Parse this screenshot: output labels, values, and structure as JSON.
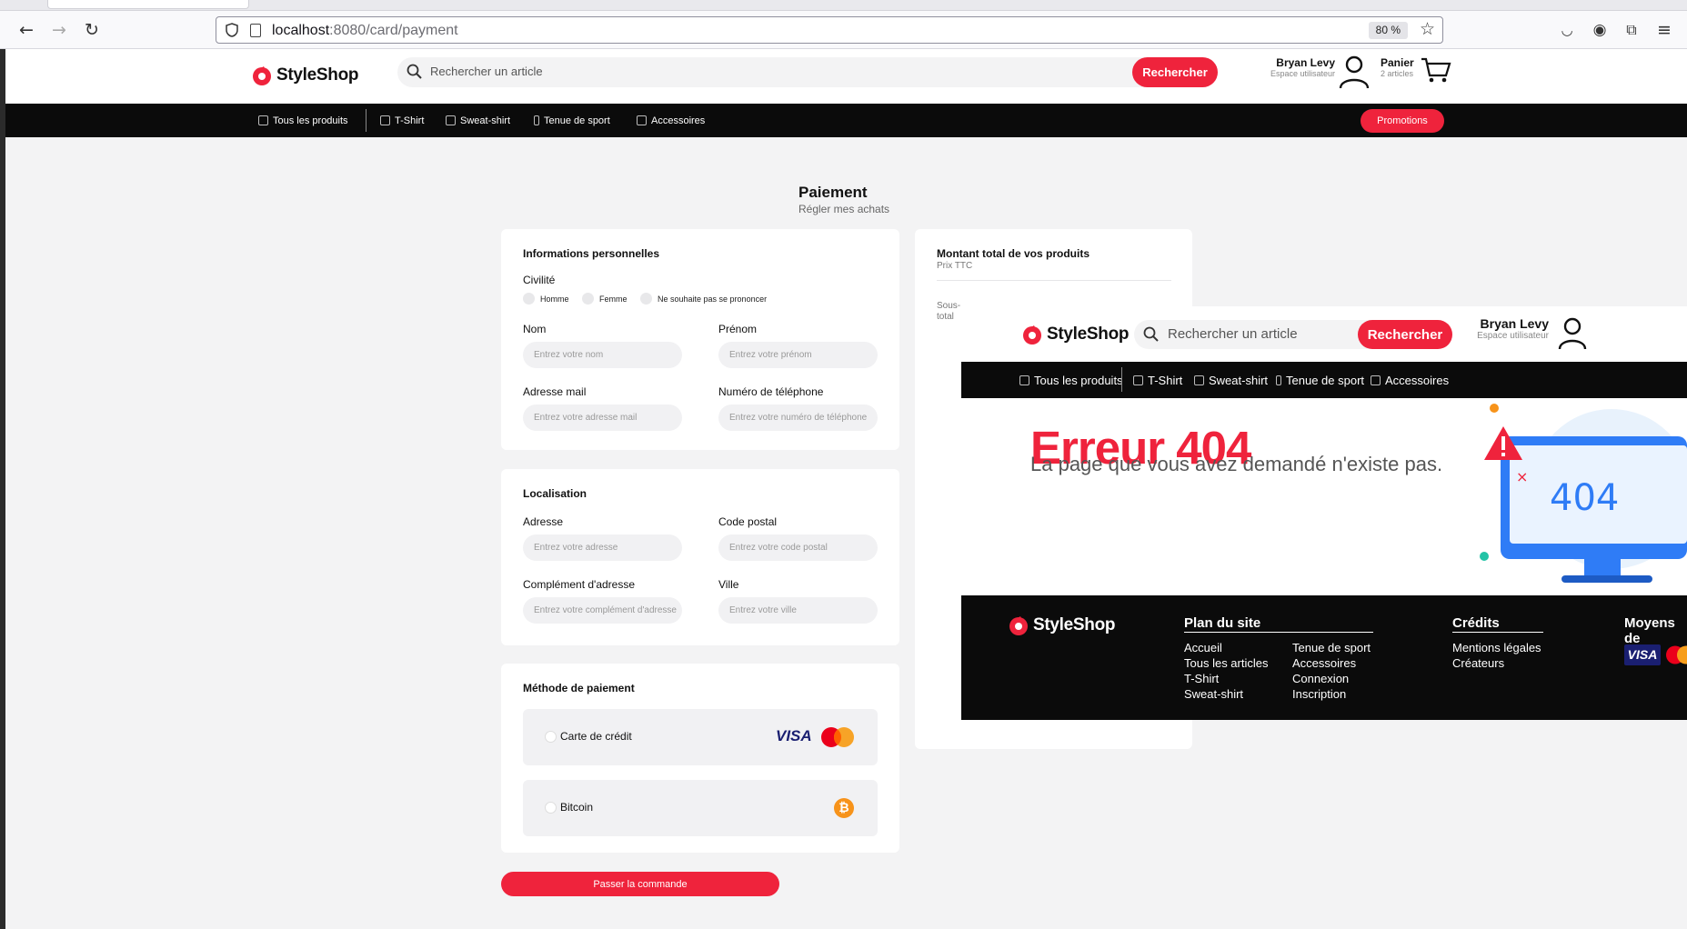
{
  "browser": {
    "url_host": "localhost",
    "url_path": ":8080/card/payment",
    "zoom": "80 %"
  },
  "header": {
    "brand": "StyleShop",
    "search_placeholder": "Rechercher un article",
    "search_button": "Rechercher",
    "user_name": "Bryan Levy",
    "user_sub": "Espace utilisateur",
    "cart_label": "Panier",
    "cart_count": "2 articles"
  },
  "nav": {
    "items": [
      "Tous les produits",
      "T-Shirt",
      "Sweat-shirt",
      "Tenue de sport",
      "Accessoires"
    ],
    "promo": "Promotions"
  },
  "page": {
    "title": "Paiement",
    "subtitle": "Régler mes achats"
  },
  "personal": {
    "title": "Informations personnelles",
    "civility_label": "Civilité",
    "civility_options": [
      "Homme",
      "Femme",
      "Ne souhaite pas se prononcer"
    ],
    "nom_label": "Nom",
    "nom_placeholder": "Entrez votre nom",
    "prenom_label": "Prénom",
    "prenom_placeholder": "Entrez votre prénom",
    "email_label": "Adresse mail",
    "email_placeholder": "Entrez votre adresse mail",
    "phone_label": "Numéro de téléphone",
    "phone_placeholder": "Entrez votre numéro de téléphone"
  },
  "location": {
    "title": "Localisation",
    "address_label": "Adresse",
    "address_placeholder": "Entrez votre adresse",
    "postal_label": "Code postal",
    "postal_placeholder": "Entrez votre code postal",
    "complement_label": "Complément d'adresse",
    "complement_placeholder": "Entrez votre complément d'adresse",
    "city_label": "Ville",
    "city_placeholder": "Entrez votre ville"
  },
  "payment": {
    "title": "Méthode de paiement",
    "credit_card": "Carte de crédit",
    "bitcoin": "Bitcoin",
    "visa_text": "VISA",
    "bitcoin_symbol": "₿"
  },
  "order_button": "Passer la commande",
  "summary": {
    "title": "Montant total de vos produits",
    "subtitle": "Prix TTC",
    "subtotal_label": "Sous-total"
  },
  "overlay": {
    "brand": "StyleShop",
    "search_placeholder": "Rechercher un article",
    "search_button": "Rechercher",
    "user_name": "Bryan Levy",
    "user_sub": "Espace utilisateur",
    "nav_items": [
      "Tous les produits",
      "T-Shirt",
      "Sweat-shirt",
      "Tenue de sport",
      "Accessoires"
    ],
    "error_title": "Erreur 404",
    "error_message": "La page que vous avez demandé n'existe pas.",
    "illustration_text": "404",
    "footer": {
      "brand": "StyleShop",
      "plan_title": "Plan du site",
      "plan_col1": [
        "Accueil",
        "Tous les articles",
        "T-Shirt",
        "Sweat-shirt"
      ],
      "plan_col2": [
        "Tenue de sport",
        "Accessoires",
        "Connexion",
        "Inscription"
      ],
      "credits_title": "Crédits",
      "credits_links": [
        "Mentions légales",
        "Créateurs"
      ],
      "payment_title": "Moyens de",
      "visa_text": "VISA"
    }
  },
  "colors": {
    "accent": "#ef233c",
    "nav_bg": "#0b0b0b",
    "page_bg": "#f3f3f4"
  }
}
